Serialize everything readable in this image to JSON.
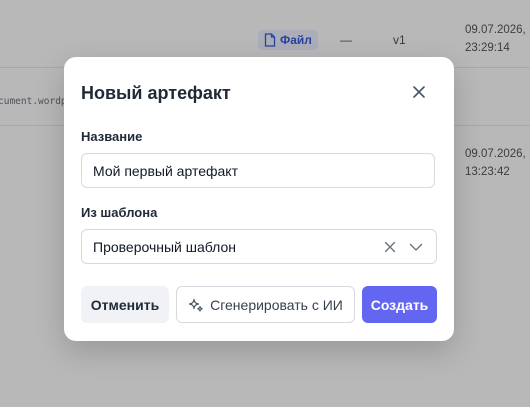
{
  "background": {
    "rows": [
      {
        "type_label": "Файл",
        "dash": "—",
        "version": "v1",
        "date": "09.07.2026,",
        "time": "23:29:14"
      },
      {
        "filename": "cument.wordp",
        "date": "09.07.2026,",
        "time": "13:23:42"
      }
    ]
  },
  "modal": {
    "title": "Новый артефакт",
    "close_icon": "close-icon",
    "name_field": {
      "label": "Название",
      "value": "Мой первый артефакт"
    },
    "template_field": {
      "label": "Из шаблона",
      "selected": "Проверочный шаблон"
    },
    "buttons": {
      "cancel": "Отменить",
      "generate": "Сгенерировать с ИИ",
      "create": "Создать"
    }
  },
  "colors": {
    "accent": "#6366f1",
    "badge_text": "#3b5bdb",
    "badge_bg": "#eef2ff"
  }
}
